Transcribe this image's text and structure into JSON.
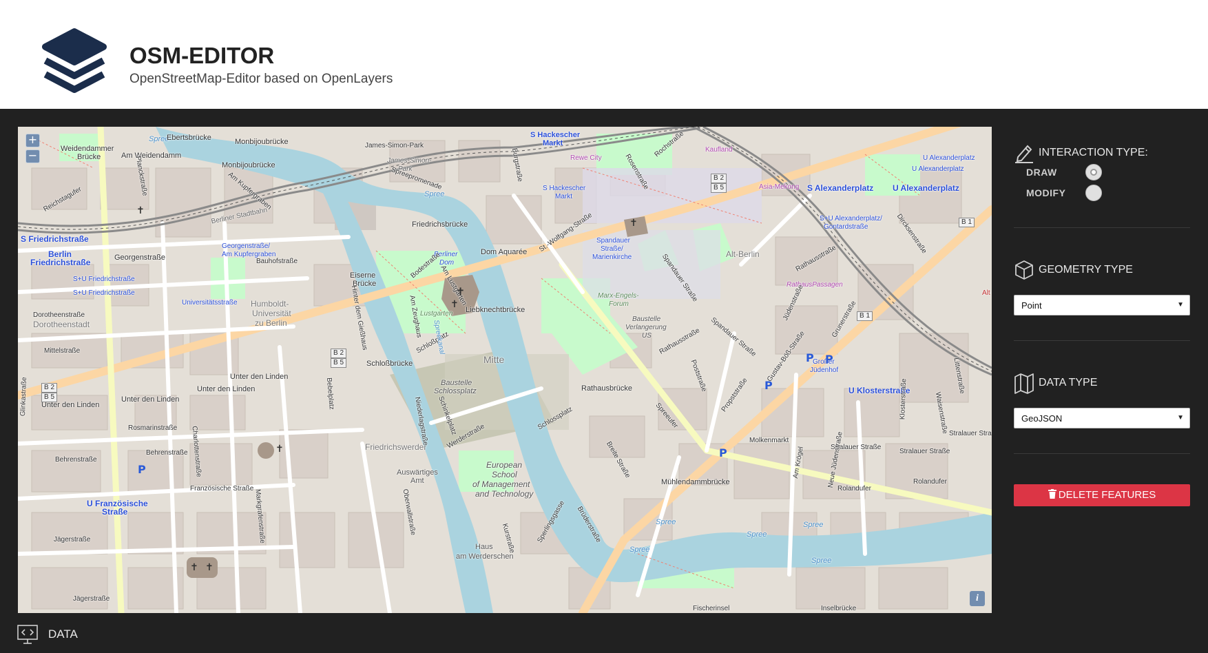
{
  "header": {
    "title": "OSM-EDITOR",
    "subtitle": "OpenStreetMap-Editor based on OpenLayers",
    "logo_icon": "layers-stack-icon",
    "logo_color": "#1b2d4b"
  },
  "map": {
    "zoom_in": "+",
    "zoom_out": "−",
    "attribution": "i",
    "labels": {
      "spree1": "Spree",
      "ebertsbruecke": "Ebertsbrücke",
      "monbijoubruecke": "Monbijoubrücke",
      "weidendammer": "Weidendammer",
      "bruecke": "Brücke",
      "am_weidendamm": "Am Weidendamm",
      "monbijoubruecke2": "Monbijoubrücke",
      "s_friedrichstr": "S Friedrichstraße",
      "berlin_friedrichstr": "Berlin",
      "friedrichstrasse": "Friedrichstraße",
      "georgenstr": "Georgenstraße",
      "su_friedrichstr": "S+U Friedrichstraße",
      "su_friedrichstr2": "S+U Friedrichstraße",
      "universitaetsstr": "Universitätsstraße",
      "humboldt": "Humboldt-",
      "universitaet": "Universität",
      "zu_berlin": "zu Berlin",
      "dorotheenstadt": "Dorotheenstadt",
      "dorotheenstr": "Dorotheenstraße",
      "mittelstr": "Mittelstraße",
      "unter_den_linden1": "Unter den Linden",
      "unter_den_linden2": "Unter den Linden",
      "unter_den_linden3": "Unter den Linden",
      "unter_den_linden4": "Unter den Linden",
      "rosmarinstr": "Rosmarinstraße",
      "behrenstr": "Behrenstraße",
      "behrenstr2": "Behrenstraße",
      "franzoesische": "Französische Straße",
      "u_franzoesische": "U Französische",
      "strasse": "Straße",
      "jaegerstr": "Jägerstraße",
      "jaegerstr2": "Jägerstraße",
      "glinkastr": "Glinkastraße",
      "am_kupfergraben": "Am Kupfergraben",
      "georgenstr_ak": "Georgenstraße/",
      "am_kupfergraben2": "Am Kupfergraben",
      "bauhofstr": "Bauhofstraße",
      "james_simon_park": "James-Simon-Park",
      "james_simon": "James-Simon-",
      "park": "Park",
      "spreepromenade": "Spreepromenade",
      "friedrichsbruecke": "Friedrichsbrücke",
      "berliner_dom": "Berliner",
      "dom": "Dom",
      "dom_aquaree": "Dom Aquarée",
      "lustgarten": "Lustgarten",
      "am_lustgarten": "Am Lustgarten",
      "eiserne": "Eiserne",
      "bruecke2": "Brücke",
      "liebknechtbruecke": "Liebknechtbrücke",
      "schlossplatz": "Schloßplatz",
      "schlossbruecke": "Schloßbrücke",
      "mitte": "Mitte",
      "baustelle": "Baustelle",
      "schlossplatz2": "Schlossplatz",
      "friedrichswerder": "Friedrichswerder",
      "auswaertiges": "Auswärtiges",
      "amt": "Amt",
      "european": "European",
      "school": "School",
      "of_management": "of Management",
      "and_technology": "and Technology",
      "haus": "Haus",
      "am_werderschen": "am Werderschen",
      "s_hackescher_markt": "S Hackescher",
      "markt": "Markt",
      "s_hackescher2": "S Hackescher",
      "markt2": "Markt",
      "rewe": "Rewe City",
      "kaufland": "Kaufland",
      "asia_mekong": "Asia-Mekong",
      "s_alexanderplatz": "S Alexanderplatz",
      "u_alexanderplatz": "U Alexanderplatz",
      "u_alexanderplatz2": "U Alexanderplatz",
      "u_alexanderplatz3": "U Alexanderplatz",
      "su_alexanderplatz": "S+U Alexanderplatz/",
      "gontardstr": "Gontardstraße",
      "alt_berlin": "Alt-Berlin",
      "rathausstr": "Rathausstraße",
      "rathauspassagen": "RathausPassagen",
      "spandauer_str": "Spandauer Straße",
      "spandauer_str2": "Spandauer Straße",
      "spandauer_marien": "Spandauer",
      "strasse_marien": "Straße/",
      "marienkirche": "Marienkirche",
      "marx_engels": "Marx-Engels-",
      "forum": "Forum",
      "baustelle_verlangerung": "Baustelle",
      "verlangerung": "Verlangerung",
      "us": "US",
      "rathausbruecke": "Rathausbrücke",
      "muehlendammbruecke": "Mühlendammbrücke",
      "molkenmarkt": "Molkenmarkt",
      "stralauer_str": "Stralauer Straße",
      "stralauer_str2": "Stralauer Straße",
      "stralauer_str3": "Stralauer Stra",
      "u_klosterstrasse": "U Klosterstraße",
      "grosser": "Großer",
      "juedenhof": "Jüdenhof",
      "grunerstr": "Grunerstraße",
      "rolandufer": "Rolandufer",
      "rolandufer2": "Rolandufer",
      "b2b5_a": "B 2",
      "b2b5_b": "B 5",
      "b2b5_c": "B 2",
      "b2b5_d": "B 5",
      "b2b5_e": "B 2",
      "b2b5_f": "B 5",
      "b1_a": "B 1",
      "b1_b": "B 1",
      "spree_water2": "Spree",
      "spree_water3": "Spree",
      "spree_water4": "Spree",
      "spree_water5": "Spree",
      "spree_water6": "Spree",
      "spree_water7": "Spree",
      "fischerinsel": "Fischerinsel",
      "inselbruecke": "Inselbrücke",
      "dircksenstr": "Dircksenstraße",
      "rochstr": "Rochstraße",
      "burgstr": "Burgstraße",
      "st_wolfgang": "St.-Wolfgang-Straße",
      "rosenstr": "Rosenstraße",
      "bodestr": "Bodestraße",
      "am_zeughaus": "Am Zeughaus",
      "spreekanal": "Spreekanal",
      "breite_str": "Breite Straße",
      "bruederstr": "Brüderstraße",
      "sperlingsgasse": "Sperlingsgasse",
      "judenstr": "Jüdenstraße",
      "kloster": "Klosterstraße",
      "littenstr": "Littenstraße",
      "waisenstr": "Waisenstraße",
      "am_kroegel": "Am Krögel",
      "gustav_boss": "Gustav-Böß-Straße",
      "propststr": "Propststraße",
      "poststr": "Poststraße",
      "rathausstr2": "Rathausstraße",
      "spreeufer": "Spreeufer",
      "werderstr": "Werderstraße",
      "oberwallstr": "Oberwallstraße",
      "niederlagstr": "Niederlagstraße",
      "schinkelplatz": "Schinkelplatz",
      "kurstr": "Kurstraße",
      "charlottenstr": "Charlottenstraße",
      "markgrafenstr": "Markgrafenstraße",
      "hinter_giesshaus": "Hinter dem Gießhaus",
      "bebelplatz": "Bebelplatz",
      "planckstr": "Planckstraße",
      "reichstagufer": "Reichstagufer",
      "schlossplatz3": "Schlossplatz",
      "neue_juedenstr": "Neue Jüdenstraße",
      "berliner_stadtbahn": "Berliner Stadtbahn",
      "alt": "Alt"
    }
  },
  "panel": {
    "interaction": {
      "title": "INTERACTION TYPE:",
      "icon": "pen-icon",
      "options": [
        {
          "label": "DRAW",
          "checked": true
        },
        {
          "label": "MODIFY",
          "checked": false
        }
      ]
    },
    "geometry": {
      "title": "GEOMETRY TYPE",
      "icon": "cube-icon",
      "selected": "Point"
    },
    "data": {
      "title": "DATA TYPE",
      "icon": "map-icon",
      "selected": "GeoJSON"
    },
    "delete_label": "DELETE FEATURES",
    "delete_icon": "trash-icon",
    "delete_color": "#dc3545"
  },
  "footer": {
    "data_label": "DATA",
    "data_icon": "monitor-code-icon"
  }
}
